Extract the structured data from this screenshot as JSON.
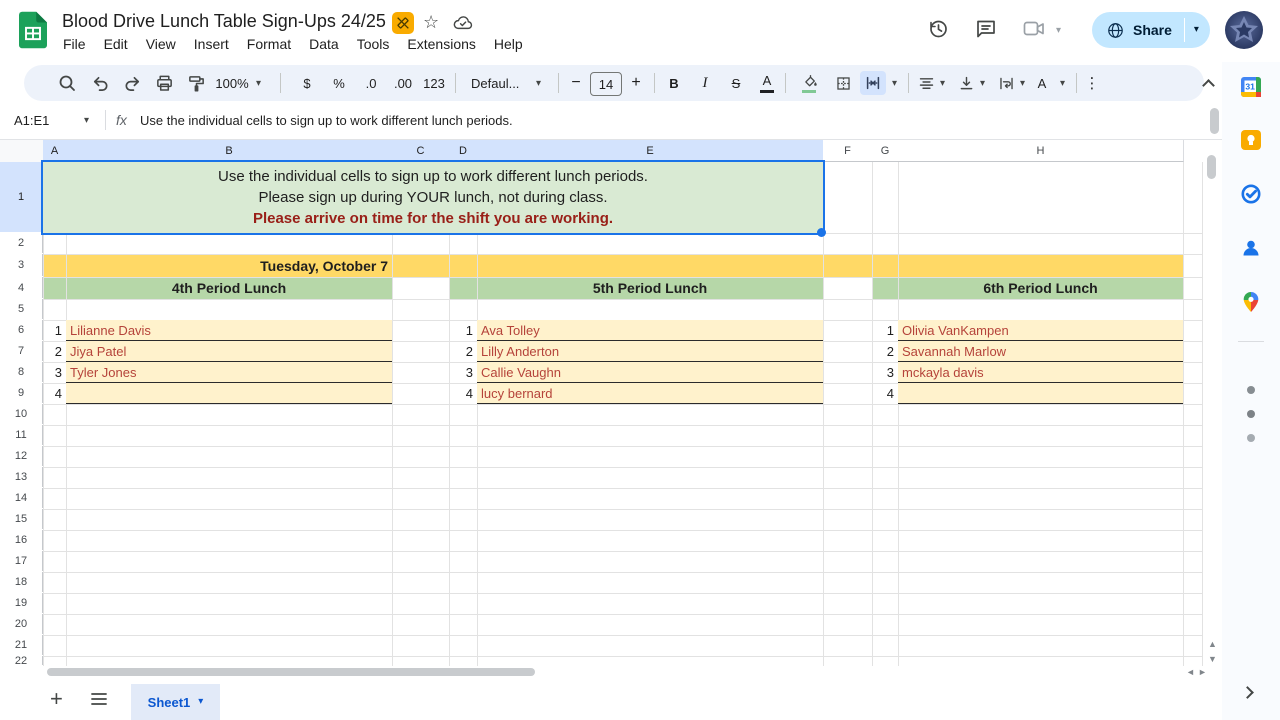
{
  "titlebar": {
    "title": "Blood Drive Lunch Table Sign-Ups 24/25",
    "menus": [
      "File",
      "Edit",
      "View",
      "Insert",
      "Format",
      "Data",
      "Tools",
      "Extensions",
      "Help"
    ],
    "share_label": "Share"
  },
  "glyphs": {
    "star": "☆",
    "caret": "▾",
    "more": "⋮",
    "bold": "B",
    "italic": "I",
    "strikethrough": "S",
    "text_color": "A",
    "rotate": "A",
    "currency": "$",
    "percent": "%",
    "decimal_decrease": ".0",
    "decimal_increase": ".00",
    "number_format": "123",
    "minus": "−",
    "plus": "+",
    "scroll_up": "▲",
    "scroll_down": "▼",
    "scroll_left": "◄",
    "scroll_right": "►"
  },
  "toolbar": {
    "zoom": "100%",
    "font_name": "Defaul...",
    "font_size": "14"
  },
  "formula_bar": {
    "name_box": "A1:E1",
    "fx": "fx",
    "formula": "Use the individual cells to sign up to work different lunch periods."
  },
  "grid": {
    "column_headers": [
      "A",
      "B",
      "C",
      "D",
      "E",
      "F",
      "G",
      "H"
    ],
    "row_numbers": [
      "1",
      "2",
      "3",
      "4",
      "5",
      "6",
      "7",
      "8",
      "9",
      "10",
      "11",
      "12",
      "13",
      "14",
      "15",
      "16",
      "17",
      "18",
      "19",
      "20",
      "21",
      "22"
    ],
    "note_lines": [
      "Use the individual cells to sign up to work different lunch periods.",
      "Please sign up during YOUR lunch, not during class.",
      "Please arrive on time for the shift you are working."
    ],
    "date_banner": "Tuesday, October 7",
    "slot_numbers": [
      "1",
      "2",
      "3",
      "4"
    ],
    "sections": [
      {
        "title": "4th Period Lunch",
        "names": [
          "Lilianne Davis",
          "Jiya Patel",
          "Tyler Jones",
          ""
        ]
      },
      {
        "title": "5th Period Lunch",
        "names": [
          "Ava Tolley",
          "Lilly Anderton",
          "Callie Vaughn",
          "lucy bernard"
        ]
      },
      {
        "title": "6th Period Lunch",
        "names": [
          "Olivia VanKampen",
          "Savannah Marlow",
          "mckayla davis",
          ""
        ]
      }
    ]
  },
  "sheet_bar": {
    "active_tab": "Sheet1"
  },
  "side_panel": {
    "calendar_label": "31"
  },
  "colors": {
    "banner_yellow": "#ffd966",
    "section_green": "#b6d7a8",
    "note_green": "#d9ead3",
    "slot_yellow": "#fff2cc",
    "name_red": "#b5433a",
    "warning_red": "#992018",
    "selection_blue": "#1a73e8",
    "share_blue": "#c2e7ff"
  }
}
